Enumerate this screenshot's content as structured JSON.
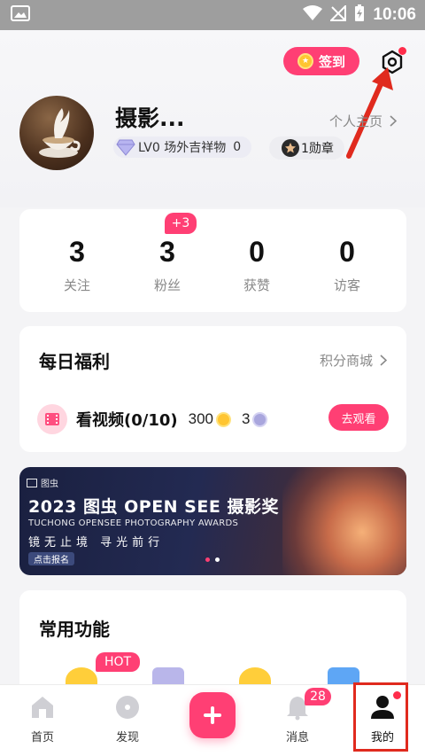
{
  "status_bar": {
    "time": "10:06"
  },
  "header": {
    "signin_label": "签到",
    "username": "摄影...",
    "profile_link": "个人主页",
    "level_label": "LV0 场外吉祥物",
    "level_count": "0",
    "badge_label": "1勋章"
  },
  "stats": {
    "followers_new": "+3",
    "items": [
      {
        "value": "3",
        "label": "关注"
      },
      {
        "value": "3",
        "label": "粉丝"
      },
      {
        "value": "0",
        "label": "获赞"
      },
      {
        "value": "0",
        "label": "访客"
      }
    ]
  },
  "welfare": {
    "title": "每日福利",
    "more_label": "积分商城",
    "task_label": "看视频(0/10)",
    "coin_reward": "300",
    "point_reward": "3",
    "action_label": "去观看"
  },
  "banner": {
    "brand": "图虫",
    "title": "2023 图虫 OPEN SEE 摄影奖",
    "subtitle": "TUCHONG OPENSEE PHOTOGRAPHY AWARDS",
    "slogan": "镜无止境 寻光前行",
    "cta": "点击报名"
  },
  "functions": {
    "title": "常用功能",
    "hot_badge": "HOT"
  },
  "bottom_nav": {
    "home": "首页",
    "discover": "发现",
    "messages": "消息",
    "messages_count": "28",
    "mine": "我的"
  },
  "colors": {
    "accent": "#ff3f74",
    "annotation": "#e02a1e",
    "status_bar": "#9e9e9e"
  }
}
